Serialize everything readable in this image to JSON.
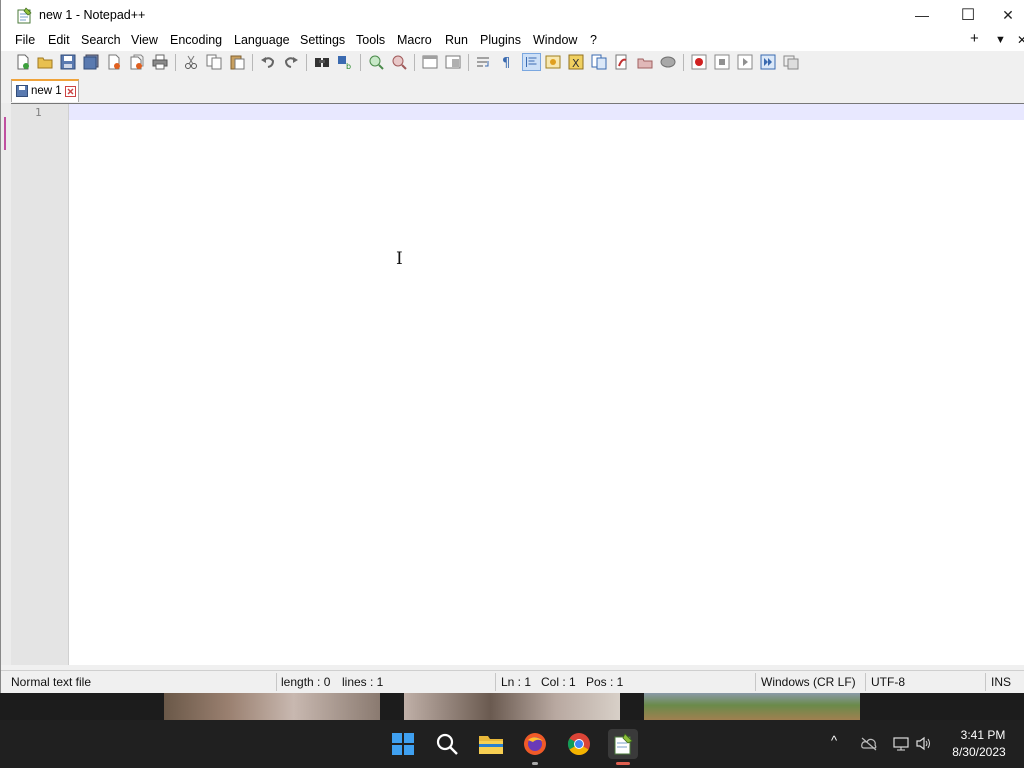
{
  "window": {
    "title": "new 1 - Notepad++",
    "controls": {
      "minimize": "—",
      "maximize": "☐",
      "close": "✕"
    }
  },
  "menu": {
    "items": [
      "File",
      "Edit",
      "Search",
      "View",
      "Encoding",
      "Language",
      "Settings",
      "Tools",
      "Macro",
      "Run",
      "Plugins",
      "Window",
      "?"
    ],
    "right": {
      "add": "+",
      "dropdown": "▼",
      "close": "✕"
    }
  },
  "toolbar": {
    "icons": [
      "new-file-icon",
      "open-file-icon",
      "save-icon",
      "save-all-icon",
      "close-icon",
      "close-all-icon",
      "print-icon",
      "cut-icon",
      "copy-icon",
      "paste-icon",
      "undo-icon",
      "redo-icon",
      "find-icon",
      "replace-icon",
      "zoom-in-icon",
      "zoom-out-icon",
      "sync-vertical-icon",
      "sync-horizontal-icon",
      "word-wrap-icon",
      "show-all-chars-icon",
      "indent-guide-icon",
      "udl-icon",
      "function-list-icon",
      "document-map-icon",
      "folder-workspace-icon",
      "monitoring-icon",
      "record-macro-icon",
      "stop-record-icon",
      "play-macro-icon",
      "run-macro-multiple-icon",
      "save-macro-icon"
    ]
  },
  "tabs": [
    {
      "label": "new 1",
      "active": true
    }
  ],
  "editor": {
    "line_numbers": [
      "1"
    ],
    "content": ""
  },
  "status": {
    "file_type": "Normal text file",
    "length": "length : 0",
    "lines": "lines : 1",
    "ln": "Ln : 1",
    "col": "Col : 1",
    "pos": "Pos : 1",
    "eol": "Windows (CR LF)",
    "encoding": "UTF-8",
    "mode": "INS"
  },
  "taskbar": {
    "apps": [
      "windows-start-icon",
      "search-icon",
      "file-explorer-icon",
      "firefox-icon",
      "chrome-icon",
      "notepadpp-icon"
    ],
    "tray": {
      "chevron": "^"
    },
    "time": "3:41 PM",
    "date": "8/30/2023"
  },
  "colors": {
    "accent_tab": "#f0a33a",
    "active_line": "#e8e8ff",
    "taskbar": "#202020"
  }
}
